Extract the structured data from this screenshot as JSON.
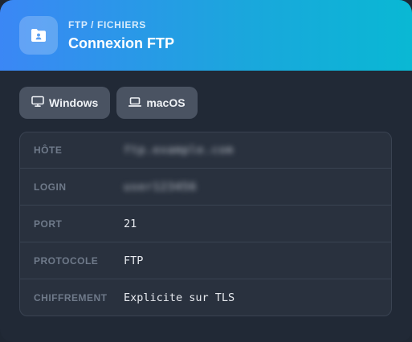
{
  "header": {
    "eyebrow": "FTP / FICHIERS",
    "title": "Connexion FTP",
    "icon": "folder-user-icon"
  },
  "os_tabs": [
    {
      "label": "Windows",
      "icon": "monitor-icon"
    },
    {
      "label": "macOS",
      "icon": "laptop-icon"
    }
  ],
  "fields": [
    {
      "label": "HÔTE",
      "value": "ftp.example.com"
    },
    {
      "label": "LOGIN",
      "value": "user123456"
    },
    {
      "label": "PORT",
      "value": "21"
    },
    {
      "label": "PROTOCOLE",
      "value": "FTP"
    },
    {
      "label": "CHIFFREMENT",
      "value": "Explicite sur TLS"
    }
  ],
  "colors": {
    "gradient_start": "#3b87f5",
    "gradient_end": "#09b8d4",
    "background": "#212936",
    "panel": "#29313e"
  }
}
